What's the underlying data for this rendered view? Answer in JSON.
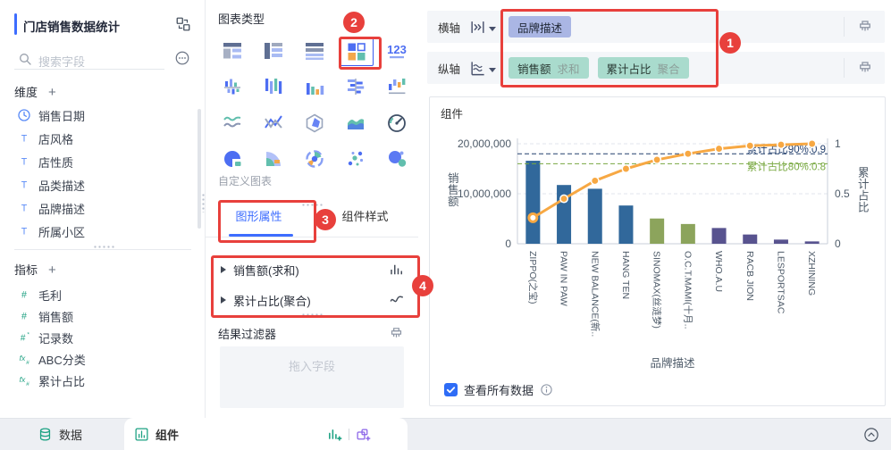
{
  "colors": {
    "accent_blue": "#3D6DFF",
    "annotation_red": "#E8403C",
    "dimension_pill": "#AAB6E4",
    "measure_pill": "#A9DBCD",
    "bar_blue": "#31689B",
    "bar_green": "#8CA45C",
    "bar_purple": "#58538F",
    "line_orange": "#F7A843"
  },
  "sidebar": {
    "title": "门店销售数据统计",
    "search_placeholder": "搜索字段",
    "dimensions": {
      "header": "维度",
      "add_label": "+",
      "items": [
        {
          "icon": "clock-icon",
          "label": "销售日期"
        },
        {
          "icon": "text-field-icon",
          "label": "店风格"
        },
        {
          "icon": "text-field-icon",
          "label": "店性质"
        },
        {
          "icon": "text-field-icon",
          "label": "品类描述"
        },
        {
          "icon": "text-field-icon",
          "label": "品牌描述"
        },
        {
          "icon": "text-field-icon",
          "label": "所属小区"
        }
      ]
    },
    "measures": {
      "header": "指标",
      "add_label": "+",
      "items": [
        {
          "icon": "hash-icon",
          "label": "毛利"
        },
        {
          "icon": "hash-icon",
          "label": "销售额"
        },
        {
          "icon": "hash-plus-icon",
          "label": "记录数"
        },
        {
          "icon": "fx-icon",
          "label": "ABC分类"
        },
        {
          "icon": "fx-icon",
          "label": "累计占比"
        }
      ]
    }
  },
  "chart_panel": {
    "title": "图表类型",
    "chart_types": [
      {
        "icon": "group-table-icon"
      },
      {
        "icon": "cross-table-icon"
      },
      {
        "icon": "detail-table-icon"
      },
      {
        "icon": "custom-chart-icon",
        "selected": true
      },
      {
        "icon": "kpi-card-icon"
      },
      {
        "icon": "bidirectional-column-icon"
      },
      {
        "icon": "range-column-icon"
      },
      {
        "icon": "column-icon"
      },
      {
        "icon": "bidirectional-bar-icon"
      },
      {
        "icon": "waterfall-icon"
      },
      {
        "icon": "area-range-icon"
      },
      {
        "icon": "combo-line-icon"
      },
      {
        "icon": "radar-icon"
      },
      {
        "icon": "area-icon"
      },
      {
        "icon": "gauge-icon"
      },
      {
        "icon": "pie-icon"
      },
      {
        "icon": "rose-icon"
      },
      {
        "icon": "multilayer-pie-icon"
      },
      {
        "icon": "scatter-icon"
      },
      {
        "icon": "bubble-icon"
      }
    ],
    "custom_chart_label": "自定义图表",
    "tabs": [
      {
        "label": "图形属性",
        "active": true
      },
      {
        "label": "组件样式",
        "active": false
      }
    ],
    "properties": [
      {
        "label": "销售额(求和)",
        "icon": "mini-bar-icon"
      },
      {
        "label": "累计占比(聚合)",
        "icon": "mini-line-icon"
      }
    ],
    "result_filter_label": "结果过滤器",
    "drop_placeholder": "拖入字段"
  },
  "shelves": {
    "x": {
      "label": "横轴",
      "pills": [
        {
          "name": "品牌描述",
          "type": "dimension"
        }
      ]
    },
    "y": {
      "label": "纵轴",
      "pills": [
        {
          "name": "销售额",
          "agg": "求和",
          "type": "measure"
        },
        {
          "name": "累计占比",
          "agg": "聚合",
          "type": "measure"
        }
      ]
    }
  },
  "canvas": {
    "component_label": "组件",
    "view_all_label": "查看所有数据"
  },
  "chart_data": {
    "type": "pareto",
    "categories": [
      "ZIPPO(之宝)",
      "PAW IN PAW",
      "NEW BALANCE(新..",
      "HANG TEN",
      "SINOMAX(丝涟梦)",
      "O.C.T.MAMI(十月..",
      "WHO.A.U",
      "RACB JION",
      "LESPORTSAC",
      "XZHINING"
    ],
    "series": [
      {
        "name": "销售额",
        "type": "bar",
        "values": [
          16600000,
          11750000,
          11000000,
          7650000,
          5050000,
          3950000,
          3150000,
          1850000,
          830000,
          470000
        ]
      },
      {
        "name": "累计占比",
        "type": "line",
        "values": [
          0.26,
          0.45,
          0.63,
          0.75,
          0.84,
          0.9,
          0.95,
          0.98,
          0.99,
          1.0
        ]
      }
    ],
    "bar_colors": [
      "#31689B",
      "#31689B",
      "#31689B",
      "#31689B",
      "#8CA45C",
      "#8CA45C",
      "#58538F",
      "#58538F",
      "#58538F",
      "#58538F"
    ],
    "line_color": "#F7A843",
    "xlabel": "品牌描述",
    "y_left": {
      "label": "销售额",
      "max": 20000000,
      "ticks": [
        {
          "v": 20000000,
          "t": "20,000,000"
        },
        {
          "v": 10000000,
          "t": "10,000,000"
        },
        {
          "v": 0,
          "t": "0"
        }
      ]
    },
    "y_right": {
      "label": "累计占比",
      "max": 1,
      "ticks": [
        {
          "v": 1,
          "t": "1"
        },
        {
          "v": 0.5,
          "t": "0.5"
        },
        {
          "v": 0,
          "t": "0"
        }
      ]
    },
    "ref_lines": [
      {
        "label": "累计占比90%:0.9",
        "value": 0.9,
        "color": "#24406E"
      },
      {
        "label": "累计占比80%:0.8",
        "value": 0.8,
        "color": "#78A840"
      }
    ],
    "grid": true,
    "legend": "none"
  },
  "footer": {
    "data_tab": "数据",
    "component_tab": "组件"
  },
  "annotations": {
    "badge_labels": [
      "1",
      "2",
      "3",
      "4"
    ]
  }
}
